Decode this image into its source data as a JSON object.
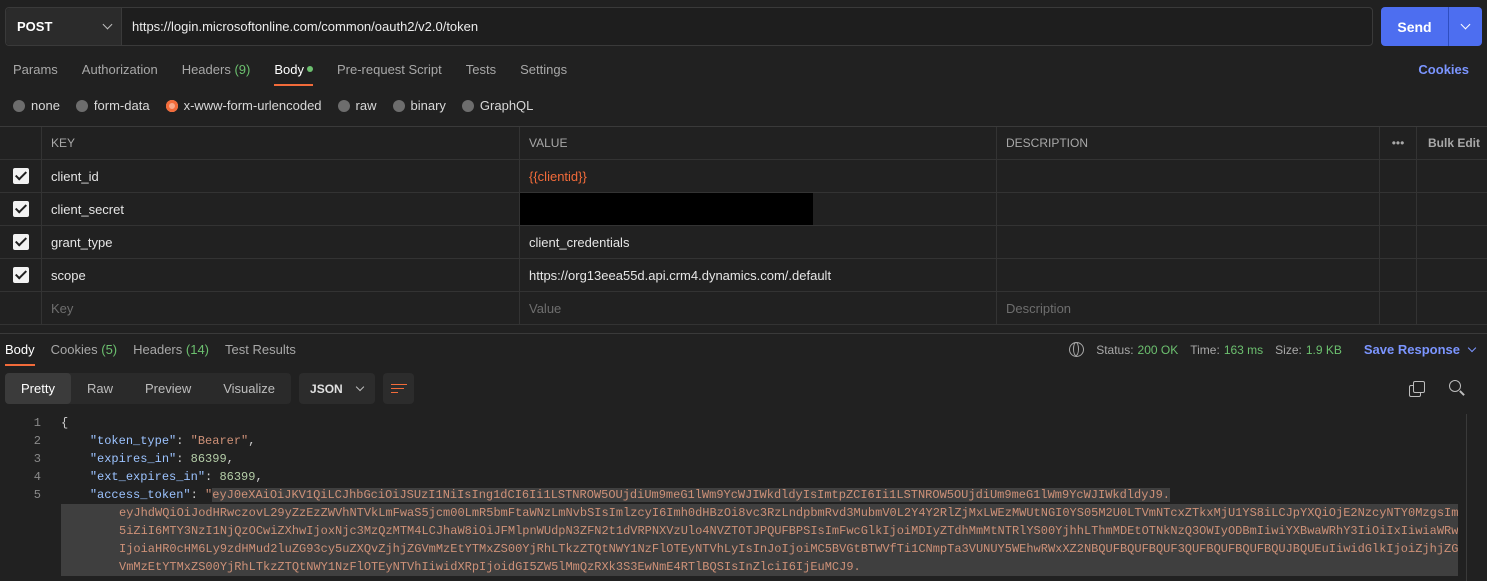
{
  "request": {
    "method": "POST",
    "url": "https://login.microsoftonline.com/common/oauth2/v2.0/token",
    "send_label": "Send"
  },
  "tabs": {
    "params": "Params",
    "authorization": "Authorization",
    "headers": "Headers",
    "headers_count": "(9)",
    "body": "Body",
    "prerequest": "Pre-request Script",
    "tests": "Tests",
    "settings": "Settings",
    "cookies": "Cookies"
  },
  "body_types": [
    "none",
    "form-data",
    "x-www-form-urlencoded",
    "raw",
    "binary",
    "GraphQL"
  ],
  "body_type_selected": "x-www-form-urlencoded",
  "table": {
    "headers": {
      "key": "KEY",
      "value": "VALUE",
      "description": "DESCRIPTION",
      "more": "•••",
      "bulk_edit": "Bulk Edit"
    },
    "rows": [
      {
        "key": "client_id",
        "value": "{{clientid}}"
      },
      {
        "key": "client_secret",
        "value": ""
      },
      {
        "key": "grant_type",
        "value": "client_credentials"
      },
      {
        "key": "scope",
        "value": "https://org13eea55d.api.crm4.dynamics.com/.default"
      }
    ],
    "placeholders": {
      "key": "Key",
      "value": "Value",
      "description": "Description"
    }
  },
  "response": {
    "tabs": {
      "body": "Body",
      "cookies": "Cookies",
      "cookies_count": "(5)",
      "headers": "Headers",
      "headers_count": "(14)",
      "test_results": "Test Results"
    },
    "status_label": "Status:",
    "status": "200 OK",
    "time_label": "Time:",
    "time": "163 ms",
    "size_label": "Size:",
    "size": "1.9 KB",
    "save_label": "Save Response",
    "views": [
      "Pretty",
      "Raw",
      "Preview",
      "Visualize"
    ],
    "format": "JSON",
    "code": {
      "l1": "{",
      "token_type_key": "\"token_type\"",
      "token_type_val": "\"Bearer\"",
      "expires_in_key": "\"expires_in\"",
      "expires_in_val": "86399",
      "ext_expires_in_key": "\"ext_expires_in\"",
      "ext_expires_in_val": "86399",
      "access_token_key": "\"access_token\"",
      "access_token_open": "\"",
      "access_token_line1": "eyJ0eXAiOiJKV1QiLCJhbGciOiJSUzI1NiIsIng1dCI6Ii1LSTNROW5OUjdiUm9meG1lWm9YcWJIWkdldyIsImtpZCI6Ii1LSTNROW5OUjdiUm9meG1lWm9YcWJIWkdldyJ9.",
      "access_token_lines": [
        "eyJhdWQiOiJodHRwczovL29yZzEzZWVhNTVkLmFwaS5jcm00LmR5bmFtaWNzLmNvbSIsImlzcyI6Imh0dHBzOi8vc3RzLndpbmRvd3MubmV0L2Y4Y2RlZjMxLWEzMWUtNGI0YS05M2U0LTVmNTcxZTkxMjU1YS8iLCJpYXQiOjE2NzcyNTY0MzgsIm",
        "5iZiI6MTY3NzI1NjQzOCwiZXhwIjoxNjc3MzQzMTM4LCJhaW8iOiJFMlpnWUdpN3ZFN2t1dVRPNXVzUlo4NVZTOTJPQUFBPSIsImFwcGlkIjoiMDIyZTdhMmMtNTRlYS00YjhhLThmMDEtOTNkNzQ3OWIyODBmIiwiYXBwaWRhY3IiOiIxIiwiaWRw",
        "IjoiaHR0cHM6Ly9zdHMud2luZG93cy5uZXQvZjhjZGVmMzEtYTMxZS00YjRhLTkzZTQtNWY1NzFlOTEyNTVhLyIsInJoIjoiMC5BVGtBTWVfTi1CNmpTa3VUNUY5WEhwRWxXZ2NBQUFBQUFBQUF3QUFBQUFBQUFBQUJBQUEuIiwidGlkIjoiZjhjZG",
        "VmMzEtYTMxZS00YjRhLTkzZTQtNWY1NzFlOTEyNTVhIiwidXRpIjoidGI5ZW5lMmQzRXk3S3EwNmE4RTlBQSIsInZlciI6IjEuMCJ9."
      ]
    }
  }
}
